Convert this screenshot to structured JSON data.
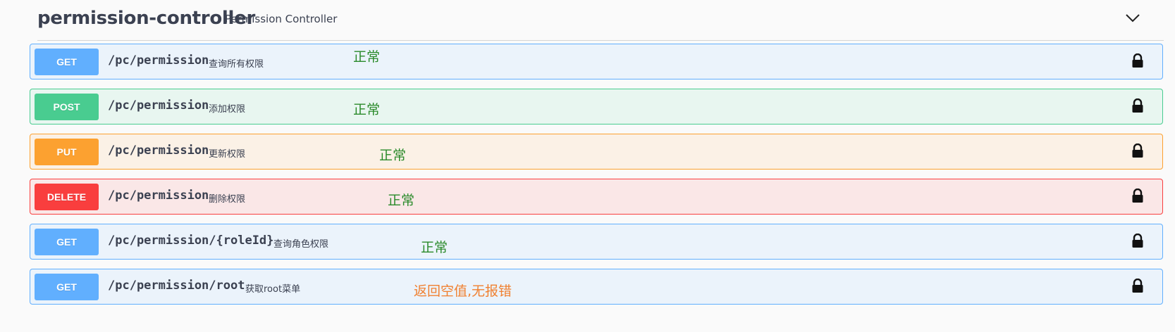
{
  "tag": {
    "name": "permission-controller",
    "description": "Permission Controller",
    "collapse_icon": "chevron-down-icon"
  },
  "operations": [
    {
      "method": "GET",
      "path": "/pc/permission",
      "summary": "查询所有权限",
      "lock_icon": "lock-icon",
      "note": "正常"
    },
    {
      "method": "POST",
      "path": "/pc/permission",
      "summary": "添加权限",
      "lock_icon": "lock-icon",
      "note": "正常"
    },
    {
      "method": "PUT",
      "path": "/pc/permission",
      "summary": "更新权限",
      "lock_icon": "lock-icon",
      "note": "正常"
    },
    {
      "method": "DELETE",
      "path": "/pc/permission",
      "summary": "删除权限",
      "lock_icon": "lock-icon",
      "note": "正常"
    },
    {
      "method": "GET",
      "path": "/pc/permission/{roleId}",
      "summary": "查询角色权限",
      "lock_icon": "lock-icon",
      "note": "正常"
    },
    {
      "method": "GET",
      "path": "/pc/permission/root",
      "summary": "获取root菜单",
      "lock_icon": "lock-icon",
      "note": "返回空值,无报错"
    }
  ],
  "colors": {
    "get": "#61affe",
    "post": "#49cc90",
    "put": "#fca130",
    "delete": "#f93e3e",
    "note_ok": "#2a8a2a",
    "note_warn": "#f08030"
  }
}
